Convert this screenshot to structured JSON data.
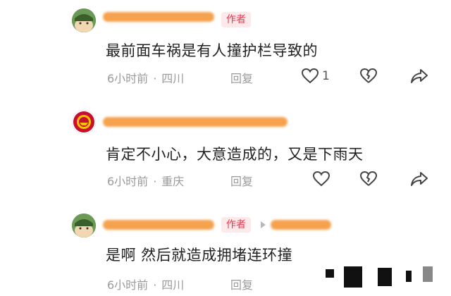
{
  "comments": [
    {
      "badge": "作者",
      "text": "最前面车祸是有人撞护栏导致的",
      "time": "6小时前",
      "location": "四川",
      "reply_label": "回复",
      "like_count": "1"
    },
    {
      "text": "肯定不小心，大意造成的，又是下雨天",
      "time": "6小时前",
      "location": "重庆",
      "reply_label": "回复"
    },
    {
      "badge": "作者",
      "text": "是啊 然后就造成拥堵连环撞",
      "time": "6小时前",
      "location": "四川",
      "reply_label": "回复"
    }
  ],
  "icons": {
    "like": "heart-outline-icon",
    "dislike": "broken-heart-icon",
    "share": "share-arrow-icon"
  },
  "colors": {
    "badge_text": "#e8384f",
    "badge_bg": "#fde8ea",
    "name_redaction": "#f5a24e",
    "meta_text": "#9a9a9a"
  }
}
